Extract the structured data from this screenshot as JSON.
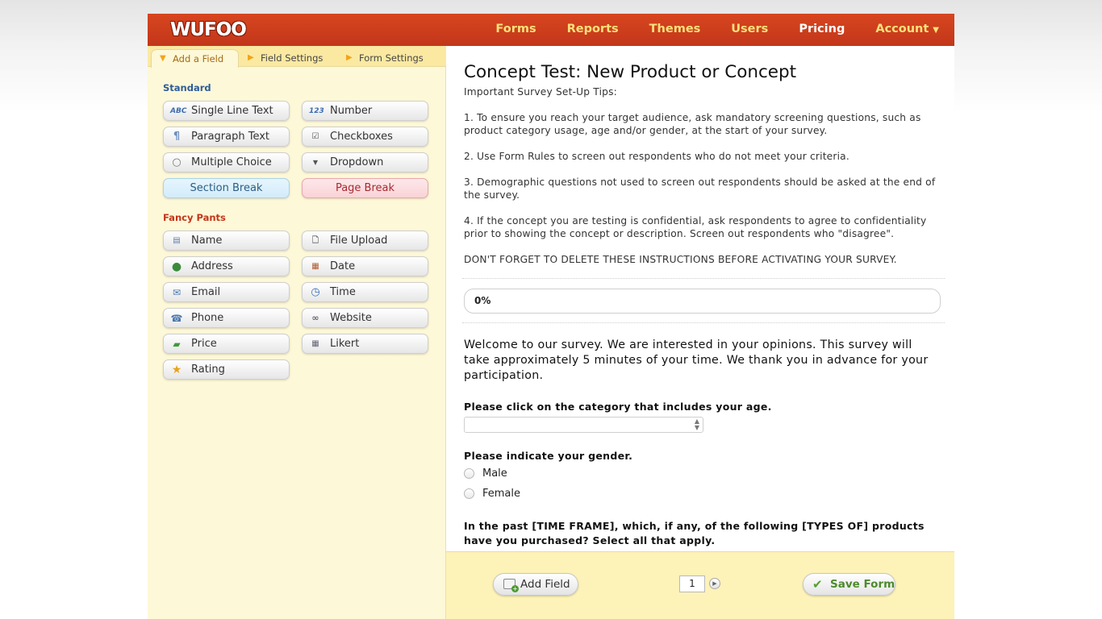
{
  "header": {
    "logo": "WUFOO",
    "nav": [
      {
        "label": "Forms",
        "active": false
      },
      {
        "label": "Reports",
        "active": false
      },
      {
        "label": "Themes",
        "active": false
      },
      {
        "label": "Users",
        "active": false
      },
      {
        "label": "Pricing",
        "active": true
      },
      {
        "label": "Account",
        "active": false
      }
    ]
  },
  "sidebar": {
    "tabs": [
      "Add a Field",
      "Field Settings",
      "Form Settings"
    ],
    "standard": {
      "title": "Standard",
      "fields": [
        {
          "label": "Single Line Text",
          "icon": "abc-icon"
        },
        {
          "label": "Number",
          "icon": "123-icon"
        },
        {
          "label": "Paragraph Text",
          "icon": "pilcrow-icon"
        },
        {
          "label": "Checkboxes",
          "icon": "checkbox-icon"
        },
        {
          "label": "Multiple Choice",
          "icon": "radio-icon"
        },
        {
          "label": "Dropdown",
          "icon": "dropdown-icon"
        },
        {
          "label": "Section Break",
          "icon": ""
        },
        {
          "label": "Page Break",
          "icon": ""
        }
      ]
    },
    "fancy": {
      "title": "Fancy Pants",
      "fields": [
        {
          "label": "Name",
          "icon": "name-card-icon"
        },
        {
          "label": "File Upload",
          "icon": "file-upload-icon"
        },
        {
          "label": "Address",
          "icon": "globe-icon"
        },
        {
          "label": "Date",
          "icon": "calendar-icon"
        },
        {
          "label": "Email",
          "icon": "envelope-icon"
        },
        {
          "label": "Time",
          "icon": "clock-icon"
        },
        {
          "label": "Phone",
          "icon": "phone-icon"
        },
        {
          "label": "Website",
          "icon": "link-icon"
        },
        {
          "label": "Price",
          "icon": "money-icon"
        },
        {
          "label": "Likert",
          "icon": "likert-icon"
        },
        {
          "label": "Rating",
          "icon": "star-icon"
        }
      ]
    }
  },
  "form": {
    "title": "Concept Test: New Product or Concept",
    "tips_heading": "Important Survey Set-Up Tips:",
    "tips": [
      "1. To ensure you reach your target audience, ask mandatory screening questions, such as product category usage, age and/or gender, at the start of your survey.",
      "2. Use Form Rules to screen out respondents who do not meet your criteria.",
      "3. Demographic questions not used to screen out respondents should be asked at the end of the survey.",
      "4. If the concept you are testing is confidential, ask respondents to agree to confidentiality prior to showing the concept or description. Screen out respondents who \"disagree\".",
      "DON'T FORGET TO DELETE THESE INSTRUCTIONS BEFORE ACTIVATING YOUR SURVEY."
    ],
    "progress_label": "0%",
    "progress_value": 0,
    "welcome": "Welcome to our survey. We are interested in your opinions. This survey will take approximately 5 minutes of your time. We thank you in advance for your participation.",
    "q_age": "Please click on the category that includes your age.",
    "q_age_value": "",
    "q_gender": "Please indicate your gender.",
    "gender_options": [
      "Male",
      "Female"
    ],
    "q_purchase": "In the past [TIME FRAME], which, if any, of the following [TYPES OF] products have you purchased? Select all that apply."
  },
  "footer": {
    "add_field": "Add Field",
    "page_number": "1",
    "save_form": "Save Form"
  },
  "colors": {
    "header_red": "#c93b1c",
    "nav_yellow": "#fce07a",
    "panel_cream": "#fdf8d7",
    "bottom_yellow": "#fdf2b8"
  }
}
